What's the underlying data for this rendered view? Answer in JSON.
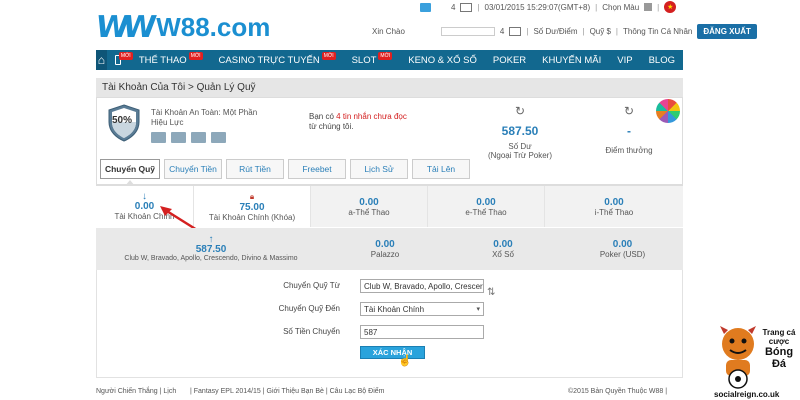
{
  "header": {
    "logo_mark": "W",
    "logo_text": "W88.com",
    "notif_count": "4",
    "datetime": "03/01/2015 15:29:07(GMT+8)",
    "choose_color": "Chọn Màu",
    "greeting": "Xin Chào",
    "mail_count": "4",
    "links": [
      "Số Dư/Điểm",
      "Quỹ $",
      "Thông Tin Cá Nhân"
    ],
    "logout": "ĐĂNG XUẤT"
  },
  "nav": {
    "items": [
      {
        "label": "THỂ THAO",
        "new": "MỚI"
      },
      {
        "label": "CASINO TRỰC TUYẾN",
        "new": "MỚI"
      },
      {
        "label": "SLOT",
        "new": "MỚI"
      },
      {
        "label": "KENO & XỔ SỐ",
        "new": ""
      },
      {
        "label": "POKER",
        "new": ""
      },
      {
        "label": "KHUYẾN MÃI",
        "new": ""
      },
      {
        "label": "VIP",
        "new": ""
      },
      {
        "label": "BLOG",
        "new": ""
      }
    ],
    "new_badge": "MỚI"
  },
  "breadcrumb": "Tài Khoản Của Tôi > Quản Lý Quỹ",
  "account": {
    "security_pct": "50%",
    "security_line1": "Tài Khoản An Toàn: Một Phần",
    "security_line2": "Hiệu Lực",
    "msg_prefix": "Bạn có ",
    "msg_highlight": "4 tin nhắn chưa đọc",
    "msg_suffix": "từ chúng tôi.",
    "balance": "587.50",
    "balance_label1": "Số Dư",
    "balance_label2": "(Ngoại Trừ Poker)",
    "points": "-",
    "points_label": "Điểm thưởng"
  },
  "tabs": [
    "Chuyển Quỹ",
    "Chuyển Tiền",
    "Rút Tiền",
    "Freebet",
    "Lịch Sử",
    "Tải Lên"
  ],
  "wallets_row1": [
    {
      "value": "0.00",
      "label": "Tài Khoản Chính"
    },
    {
      "value": "75.00",
      "label": "Tài Khoản Chính (Khóa)"
    },
    {
      "value": "0.00",
      "label": "a-Thể Thao"
    },
    {
      "value": "0.00",
      "label": "e-Thể Thao"
    },
    {
      "value": "0.00",
      "label": "i-Thể Thao"
    }
  ],
  "wallets_row2": [
    {
      "value": "587.50",
      "label": "Club W, Bravado, Apollo, Crescendo, Divino & Massimo"
    },
    {
      "value": "0.00",
      "label": "Palazzo"
    },
    {
      "value": "0.00",
      "label": "Xổ Số"
    },
    {
      "value": "0.00",
      "label": "Poker (USD)"
    }
  ],
  "form": {
    "from_label": "Chuyển Quỹ Từ",
    "from_value": "Club W, Bravado, Apollo, Crescer",
    "to_label": "Chuyển Quỹ Đến",
    "to_value": "Tài Khoản Chính",
    "amount_label": "Số Tiền Chuyển",
    "amount_value": "587",
    "confirm": "XÁC NHẬN"
  },
  "footer": {
    "left": "Người Chiến Thắng  |  Lịch",
    "mid": "|  Fantasy EPL 2014/15  |  Giới Thiệu Bạn Bè  |  Câu Lạc Bộ Điểm",
    "right": "©2015 Bản Quyền Thuộc W88  |"
  },
  "watermark": {
    "line1": "Trang cá",
    "line2": "cược",
    "line3": "Bóng",
    "line4": "Đá",
    "site": "socialreign.co.uk"
  }
}
